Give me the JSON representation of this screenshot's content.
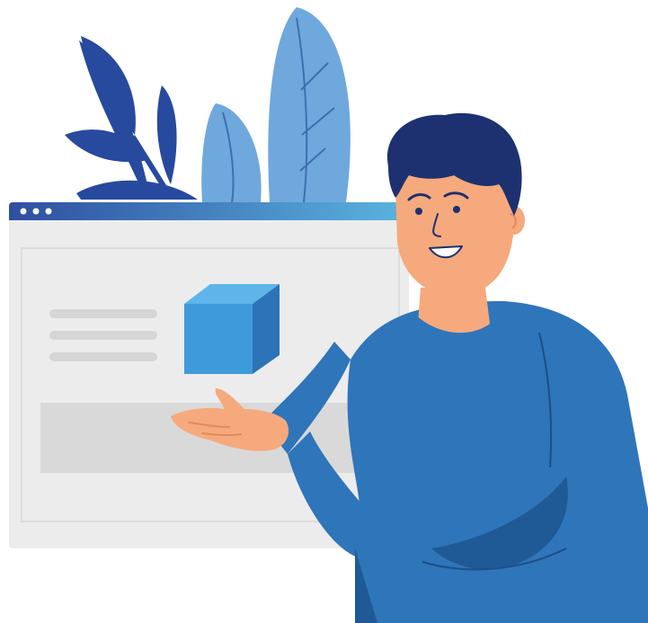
{
  "illustration": {
    "browser_window": {
      "titlebar_dots": 3,
      "content_lines": 3
    },
    "colors": {
      "background": "#ffffff",
      "window_body": "#ececec",
      "window_border": "#e0e0e0",
      "window_panel": "#d9d9d9",
      "window_lines": "#d6d6d6",
      "titlebar_start": "#2f4ea0",
      "titlebar_end": "#5ab4df",
      "titlebar_dots": "#ffffff",
      "leaf_dark": "#274a9f",
      "leaf_light": "#6fa8dc",
      "leaf_vein": "#3d6fb0",
      "cube_front": "#3f9ad9",
      "cube_top": "#5db5e9",
      "cube_side": "#2c73b8",
      "skin": "#f6a97c",
      "skin_shadow": "#e18a5e",
      "hair": "#1d3170",
      "shirt": "#2f75ba",
      "shirt_shadow": "#1f5a97",
      "shirt_line": "#1c4f86"
    },
    "icons": [
      "window-dot-icon",
      "cube-icon",
      "leaf-icon"
    ]
  }
}
